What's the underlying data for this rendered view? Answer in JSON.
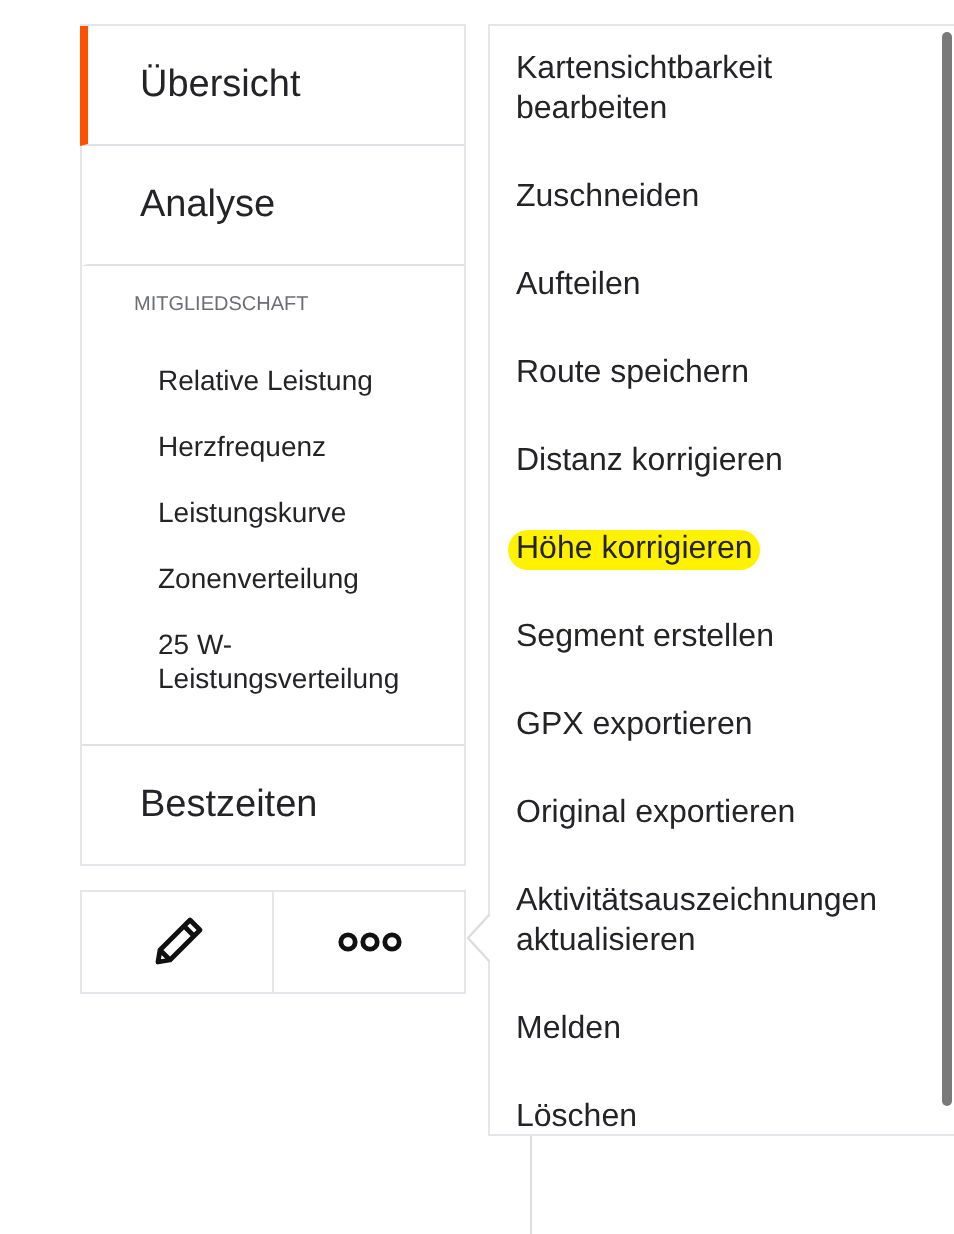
{
  "sidebar": {
    "items": [
      {
        "label": "Übersicht",
        "selected": true
      },
      {
        "label": "Analyse",
        "selected": false
      }
    ],
    "membership": {
      "heading": "MITGLIEDSCHAFT",
      "items": [
        {
          "label": "Relative Leistung"
        },
        {
          "label": "Herzfrequenz"
        },
        {
          "label": "Leistungskurve"
        },
        {
          "label": "Zonenverteilung"
        },
        {
          "label": "25 W-Leistungsverteilung"
        }
      ]
    },
    "footer_items": [
      {
        "label": "Bestzeiten",
        "selected": false
      }
    ]
  },
  "actions_menu": {
    "items": [
      {
        "label": "Kartensichtbarkeit bearbeiten",
        "highlighted": false
      },
      {
        "label": "Zuschneiden",
        "highlighted": false
      },
      {
        "label": "Aufteilen",
        "highlighted": false
      },
      {
        "label": "Route speichern",
        "highlighted": false
      },
      {
        "label": "Distanz korrigieren",
        "highlighted": false
      },
      {
        "label": "Höhe korrigieren",
        "highlighted": true
      },
      {
        "label": "Segment erstellen",
        "highlighted": false
      },
      {
        "label": "GPX exportieren",
        "highlighted": false
      },
      {
        "label": "Original exportieren",
        "highlighted": false
      },
      {
        "label": "Aktivitätsauszeichnungen aktualisieren",
        "highlighted": false
      },
      {
        "label": "Melden",
        "highlighted": false
      },
      {
        "label": "Löschen",
        "highlighted": false
      }
    ]
  }
}
